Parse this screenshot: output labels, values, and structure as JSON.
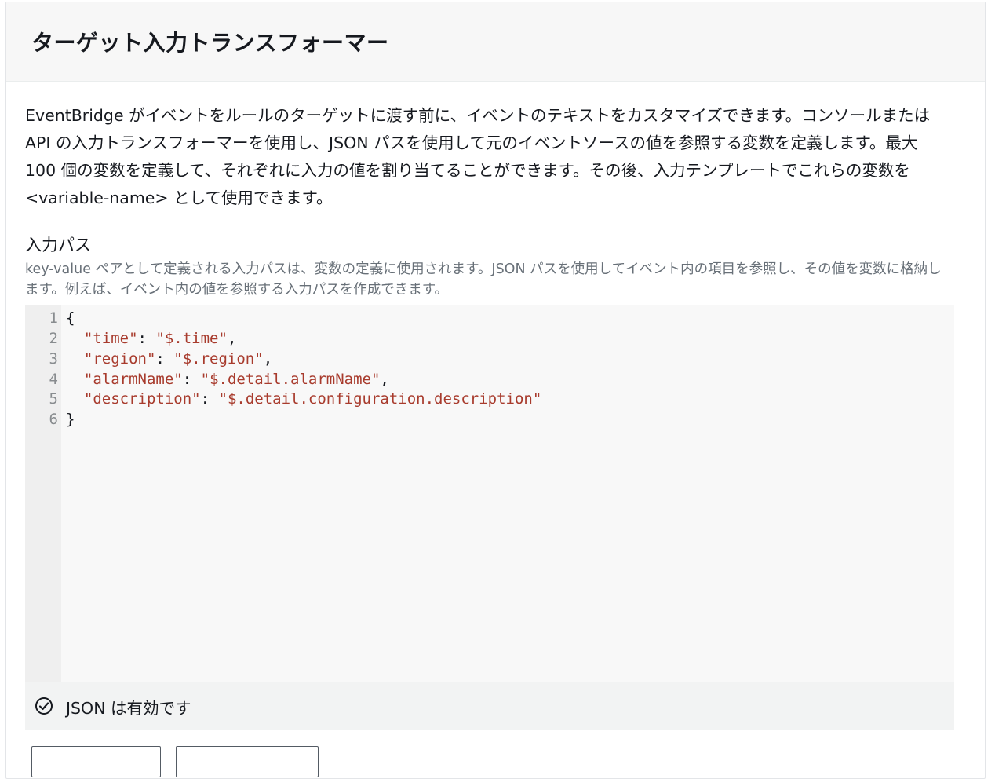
{
  "panel": {
    "title": "ターゲット入力トランスフォーマー",
    "description": "EventBridge がイベントをルールのターゲットに渡す前に、イベントのテキストをカスタマイズできます。コンソールまたは API の入力トランスフォーマーを使用し、JSON パスを使用して元のイベントソースの値を参照する変数を定義します。最大 100 個の変数を定義して、それぞれに入力の値を割り当てることができます。その後、入力テンプレートでこれらの変数を <variable-name> として使用できます。"
  },
  "input_path": {
    "label": "入力パス",
    "help": "key-value ペアとして定義される入力パスは、変数の定義に使用されます。JSON パスを使用してイベント内の項目を参照し、その値を変数に格納します。例えば、イベント内の値を参照する入力パスを作成できます。",
    "editor": {
      "line_numbers": [
        "1",
        "2",
        "3",
        "4",
        "5",
        "6"
      ],
      "lines": [
        {
          "open": "{"
        },
        {
          "key": "\"time\"",
          "sep": ": ",
          "value": "\"$.time\"",
          "end": ","
        },
        {
          "key": "\"region\"",
          "sep": ": ",
          "value": "\"$.region\"",
          "end": ","
        },
        {
          "key": "\"alarmName\"",
          "sep": ": ",
          "value": "\"$.detail.alarmName\"",
          "end": ","
        },
        {
          "key": "\"description\"",
          "sep": ": ",
          "value": "\"$.detail.configuration.description\"",
          "end": ""
        },
        {
          "close": "}"
        }
      ],
      "status_icon": "check-circle-icon",
      "status_text": "JSON は有効です"
    }
  },
  "colors": {
    "string": "#a83b2d",
    "text": "#16191f",
    "muted": "#687078"
  }
}
